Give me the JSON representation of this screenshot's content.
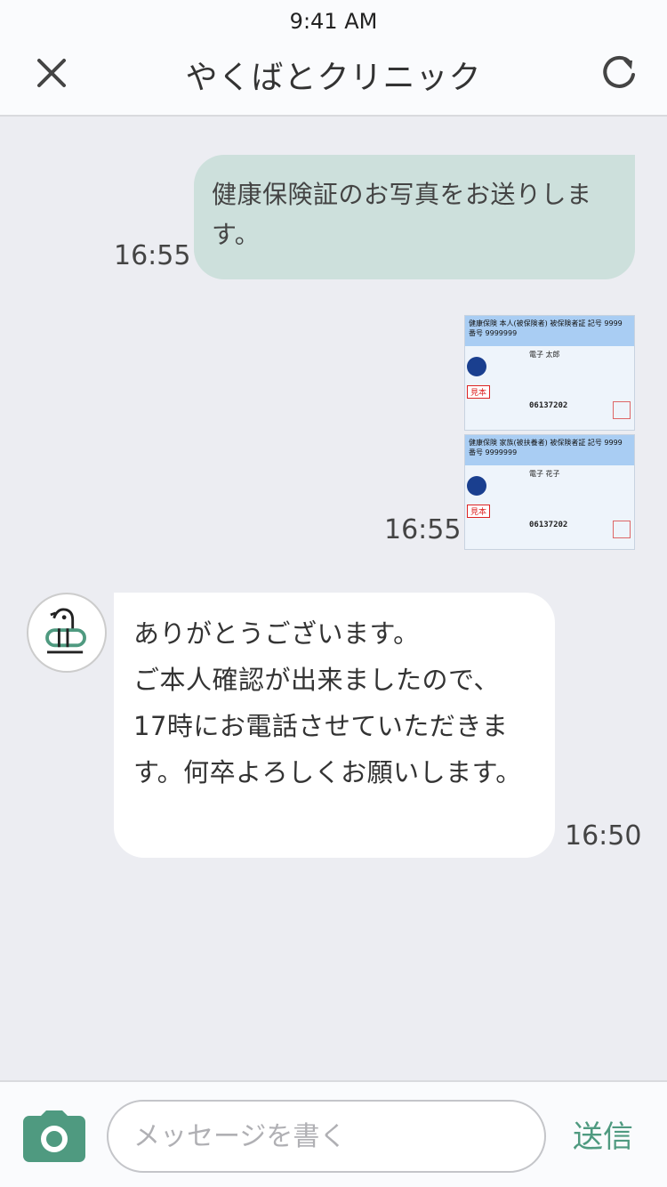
{
  "status_bar": {
    "time": "9:41 AM"
  },
  "header": {
    "title": "やくばとクリニック"
  },
  "messages": [
    {
      "direction": "outgoing",
      "type": "text",
      "text": "健康保険証のお写真をお送りします。",
      "time": "16:55"
    },
    {
      "direction": "outgoing",
      "type": "image",
      "time": "16:55",
      "cards": [
        {
          "header": "健康保険 本人(被保険者) 被保険者証 記号 9999 番号 9999999",
          "name": "電子 太郎",
          "stamp": "見本",
          "number": "06137202"
        },
        {
          "header": "健康保険 家族(被扶養者) 被保険者証 記号 9999 番号 9999999",
          "name": "電子 花子",
          "stamp": "見本",
          "number": "06137202"
        }
      ]
    },
    {
      "direction": "incoming",
      "type": "text",
      "text": "ありがとうございます。\nご本人確認が出来ましたので、\n17時にお電話させていただきます。何卒よろしくお願いします。",
      "time": "16:50"
    }
  ],
  "composer": {
    "placeholder": "メッセージを書く",
    "send_label": "送信"
  },
  "colors": {
    "accent": "#4f9a80",
    "outgoing_bubble": "#cde0dc",
    "card_header": "#a9cdf3"
  }
}
